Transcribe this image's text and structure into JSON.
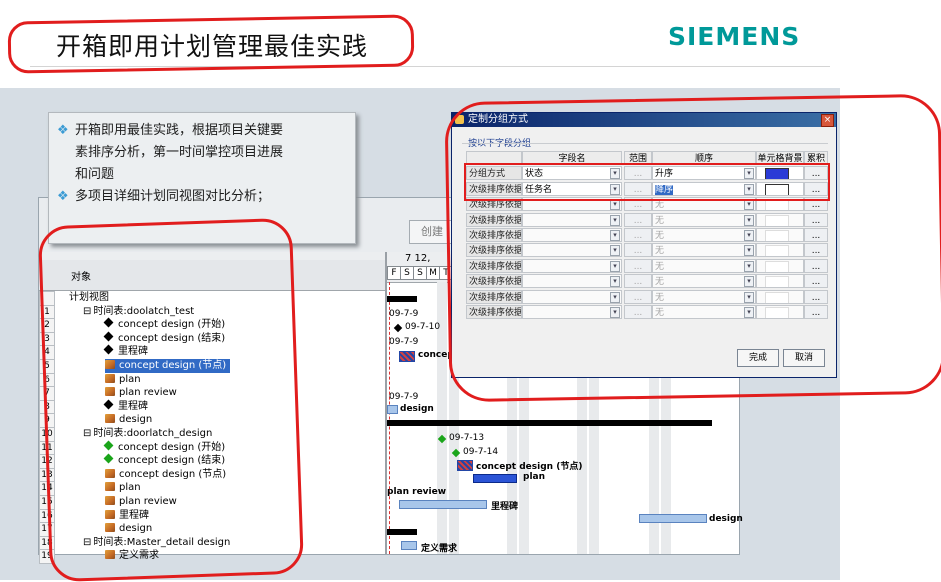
{
  "header": {
    "title": "开箱即用计划管理最佳实践",
    "logo": "SIEMENS"
  },
  "bullets": [
    {
      "lines": [
        "开箱即用最佳实践，根据项目关键要",
        "素排序分析，第一时间掌控项目进展",
        "和问题"
      ]
    },
    {
      "lines": [
        "多项目详细计划同视图对比分析；"
      ]
    }
  ],
  "app": {
    "create_button": "创建",
    "object_header": "对象",
    "dates_header": "7 12,",
    "days": [
      "F",
      "S",
      "S",
      "M",
      "T"
    ],
    "rows": [
      {
        "num": "",
        "text": "计划视图",
        "indent": 30,
        "icon": "none"
      },
      {
        "num": "1",
        "text": "时间表:doolatch_test",
        "indent": 44,
        "icon": "none"
      },
      {
        "num": "2",
        "text": "concept design (开始)",
        "indent": 66,
        "icon": "black-diamond"
      },
      {
        "num": "3",
        "text": "concept design (结束)",
        "indent": 66,
        "icon": "black-diamond"
      },
      {
        "num": "4",
        "text": "里程碑",
        "indent": 66,
        "icon": "black-diamond"
      },
      {
        "num": "5",
        "text": "concept design (节点)",
        "indent": 66,
        "icon": "task-box",
        "selected": true
      },
      {
        "num": "6",
        "text": "plan",
        "indent": 66,
        "icon": "task-box"
      },
      {
        "num": "7",
        "text": "plan review",
        "indent": 66,
        "icon": "task-box"
      },
      {
        "num": "8",
        "text": "里程碑",
        "indent": 66,
        "icon": "black-diamond"
      },
      {
        "num": "9",
        "text": "design",
        "indent": 66,
        "icon": "task-box"
      },
      {
        "num": "10",
        "text": "时间表:doorlatch_design",
        "indent": 44,
        "icon": "none"
      },
      {
        "num": "11",
        "text": "concept design (开始)",
        "indent": 66,
        "icon": "green-diamond"
      },
      {
        "num": "12",
        "text": "concept design (结束)",
        "indent": 66,
        "icon": "green-diamond"
      },
      {
        "num": "13",
        "text": "concept design (节点)",
        "indent": 66,
        "icon": "task-box"
      },
      {
        "num": "14",
        "text": "plan",
        "indent": 66,
        "icon": "task-box"
      },
      {
        "num": "15",
        "text": "plan review",
        "indent": 66,
        "icon": "task-box"
      },
      {
        "num": "16",
        "text": "里程碑",
        "indent": 66,
        "icon": "task-box"
      },
      {
        "num": "17",
        "text": "design",
        "indent": 66,
        "icon": "task-box"
      },
      {
        "num": "18",
        "text": "时间表:Master_detail design",
        "indent": 44,
        "icon": "none"
      },
      {
        "num": "19",
        "text": "定义需求",
        "indent": 66,
        "icon": "task-box"
      }
    ],
    "gantt_labels": {
      "d1": "09-7-9",
      "d2": "09-7-10",
      "d3": "09-7-9",
      "concept": "concept",
      "d4": "09-7-9",
      "design": "design",
      "d5": "09-7-13",
      "d6": "09-7-14",
      "concept2": "concept design (节点)",
      "plan": "plan",
      "plan_review": "plan review",
      "milestone": "里程碑",
      "design2": "design",
      "req": "定义需求"
    }
  },
  "dialog": {
    "title": "定制分组方式",
    "subtitle": "按以下字段分组",
    "columns": [
      "字段名",
      "范围",
      "顺序",
      "单元格背景",
      "累积"
    ],
    "rows": [
      {
        "label": "分组方式",
        "field": "状态",
        "order": "升序",
        "active": true,
        "color": "#2a3bd6"
      },
      {
        "label": "次级排序依据",
        "field": "任务名",
        "order": "降序",
        "active": true,
        "color": "#ffffff"
      },
      {
        "label": "次级排序依据",
        "field": "",
        "order": "无",
        "active": false
      },
      {
        "label": "次级排序依据",
        "field": "",
        "order": "无",
        "active": false
      },
      {
        "label": "次级排序依据",
        "field": "",
        "order": "无",
        "active": false
      },
      {
        "label": "次级排序依据",
        "field": "",
        "order": "无",
        "active": false
      },
      {
        "label": "次级排序依据",
        "field": "",
        "order": "无",
        "active": false
      },
      {
        "label": "次级排序依据",
        "field": "",
        "order": "无",
        "active": false
      },
      {
        "label": "次级排序依据",
        "field": "",
        "order": "无",
        "active": false
      },
      {
        "label": "次级排序依据",
        "field": "",
        "order": "无",
        "active": false
      }
    ],
    "dots_label": "...",
    "ok_button": "完成",
    "cancel_button": "取消"
  },
  "colors": {
    "logo": "#009999",
    "annotation": "#e11d1d",
    "selection": "#316ac5"
  }
}
